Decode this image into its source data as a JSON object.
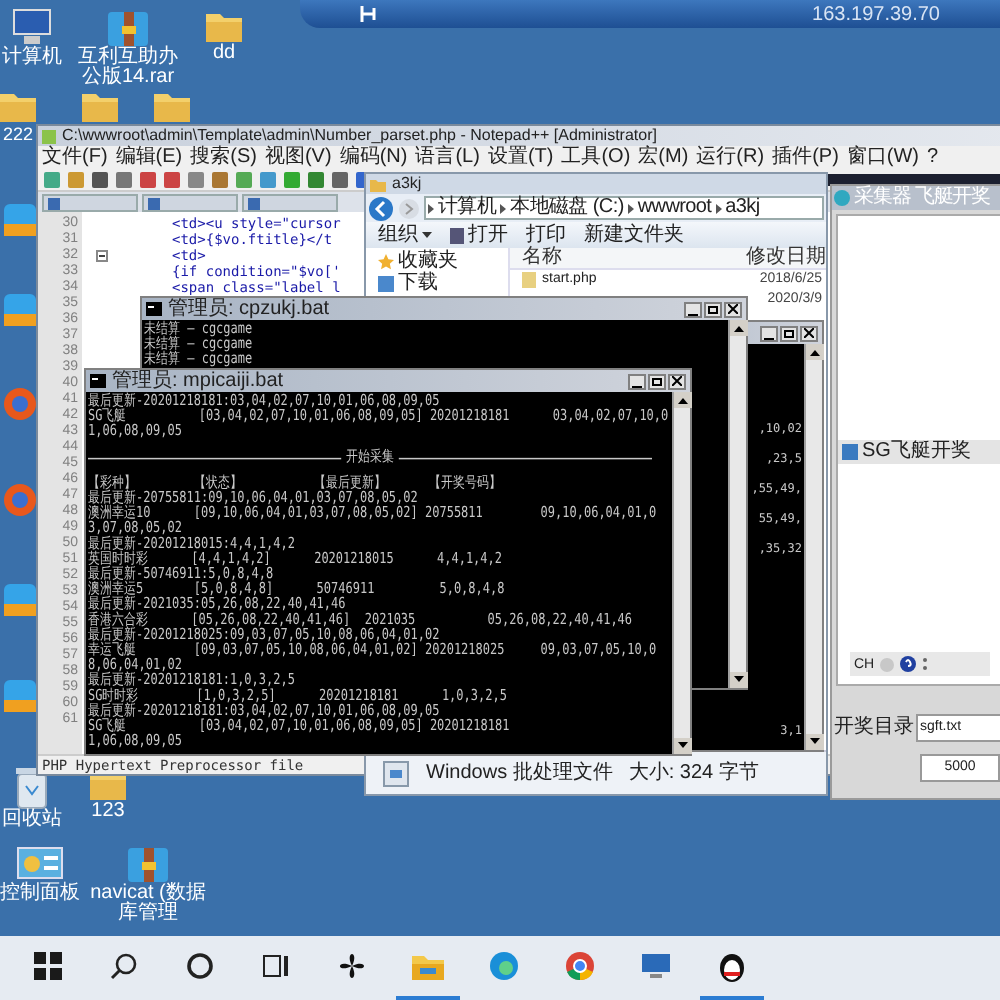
{
  "remote_bar": {
    "address": "163.197.39.70"
  },
  "desktop_icons": [
    {
      "kind": "computer",
      "label": "计算机"
    },
    {
      "kind": "archive",
      "label": "互利互助办公版14.rar"
    },
    {
      "kind": "folder",
      "label": "dd"
    },
    {
      "kind": "folder",
      "label": "222"
    },
    {
      "kind": "folder"
    },
    {
      "kind": "folder"
    },
    {
      "kind": "app"
    },
    {
      "kind": "app"
    },
    {
      "kind": "browser"
    },
    {
      "kind": "browser"
    },
    {
      "kind": "app"
    },
    {
      "kind": "app"
    },
    {
      "kind": "recycle",
      "label": "回收站"
    },
    {
      "kind": "folder",
      "label": "123"
    },
    {
      "kind": "control",
      "label": "控制面板"
    },
    {
      "kind": "archive",
      "label": "navicat (数据库管理"
    }
  ],
  "notepad": {
    "title": "C:\\wwwroot\\admin\\Template\\admin\\Number_parset.php - Notepad++ [Administrator]",
    "menu": [
      "文件(F)",
      "编辑(E)",
      "搜索(S)",
      "视图(V)",
      "编码(N)",
      "语言(L)",
      "设置(T)",
      "工具(O)",
      "宏(M)",
      "运行(R)",
      "插件(P)",
      "窗口(W)",
      "?"
    ],
    "line_numbers": [
      "30",
      "31",
      "32",
      "33",
      "34",
      "35",
      "36",
      "37",
      "38",
      "39",
      "40",
      "41",
      "42",
      "43",
      "44",
      "45",
      "46",
      "47",
      "48",
      "49",
      "50",
      "51",
      "52",
      "53",
      "54",
      "55",
      "56",
      "57",
      "58",
      "59",
      "60",
      "61"
    ],
    "code_lines": [
      {
        "text": "<td><u style=\"cursor",
        "fold": false
      },
      {
        "text": "<td>{$vo.ftitle}</t",
        "fold": false
      },
      {
        "text": "<td>",
        "fold": true
      },
      {
        "text": "{if condition=\"$vo['",
        "fold": false
      },
      {
        "text": "<span class=\"label l",
        "fold": false
      }
    ],
    "status": "PHP Hypertext Preprocessor file"
  },
  "explorer": {
    "title": "a3kj",
    "path": [
      "计算机",
      "本地磁盘 (C:)",
      "wwwroot",
      "a3kj"
    ],
    "toolbar": [
      "组织",
      "打开",
      "打印",
      "新建文件夹"
    ],
    "nav": [
      "收藏夹",
      "下载"
    ],
    "columns": [
      "名称",
      "修改日期"
    ],
    "files": [
      {
        "name": "start.php",
        "date": "2018/6/25"
      },
      {
        "date": "2020/3/9"
      }
    ],
    "status_type": "Windows 批处理文件",
    "status_size": "大小: 324 字节"
  },
  "consoles": [
    {
      "lines": [
        {
          "kind": "text",
          "text": ",10,02"
        },
        {
          "kind": "text",
          "text": ",23,5"
        },
        {
          "kind": "text",
          "text": ",55,49,"
        },
        {
          "kind": "text",
          "text": "55,49,"
        },
        {
          "kind": "text",
          "text": ",35,32"
        },
        {
          "kind": "text",
          "text": "3,1"
        }
      ]
    },
    {
      "title": "管理员: cpzukj.bat",
      "lines": [
        {
          "kind": "text",
          "text": "未结算 — cgcgame"
        },
        {
          "kind": "text",
          "text": "未结算 — cgcgame"
        },
        {
          "kind": "text",
          "text": "未结算 — cgcgame"
        }
      ]
    },
    {
      "title": "管理员: mpicaiji.bat",
      "lines": [
        {
          "kind": "text",
          "text": "最后更新-20201218181:03,04,02,07,10,01,06,08,09,05"
        },
        {
          "kind": "text",
          "text": "SG飞艇          [03,04,02,07,10,01,06,08,09,05] 20201218181      03,04,02,07,10,0"
        },
        {
          "kind": "text",
          "text": "1,06,08,09,05"
        },
        {
          "kind": "rule",
          "text": "开始采集"
        },
        {
          "kind": "text",
          "text": "【彩种】        【状态】          【最后更新】      【开奖号码】"
        },
        {
          "kind": "text",
          "text": "最后更新-20755811:09,10,06,04,01,03,07,08,05,02"
        },
        {
          "kind": "text",
          "text": "澳洲幸运10      [09,10,06,04,01,03,07,08,05,02] 20755811        09,10,06,04,01,0"
        },
        {
          "kind": "text",
          "text": "3,07,08,05,02"
        },
        {
          "kind": "text",
          "text": "最后更新-20201218015:4,4,1,4,2"
        },
        {
          "kind": "text",
          "text": "英国时时彩      [4,4,1,4,2]      20201218015      4,4,1,4,2"
        },
        {
          "kind": "text",
          "text": "最后更新-50746911:5,0,8,4,8"
        },
        {
          "kind": "text",
          "text": "澳洲幸运5       [5,0,8,4,8]      50746911         5,0,8,4,8"
        },
        {
          "kind": "text",
          "text": "最后更新-2021035:05,26,08,22,40,41,46"
        },
        {
          "kind": "text",
          "text": "香港六合彩      [05,26,08,22,40,41,46]  2021035          05,26,08,22,40,41,46"
        },
        {
          "kind": "text",
          "text": "最后更新-20201218025:09,03,07,05,10,08,06,04,01,02"
        },
        {
          "kind": "text",
          "text": "幸运飞艇        [09,03,07,05,10,08,06,04,01,02] 20201218025     09,03,07,05,10,0"
        },
        {
          "kind": "text",
          "text": "8,06,04,01,02"
        },
        {
          "kind": "text",
          "text": "最后更新-20201218181:1,0,3,2,5"
        },
        {
          "kind": "text",
          "text": "SG时时彩        [1,0,3,2,5]      20201218181      1,0,3,2,5"
        },
        {
          "kind": "text",
          "text": "最后更新-20201218181:03,04,02,07,10,01,06,08,09,05"
        },
        {
          "kind": "text",
          "text": "SG飞艇          [03,04,02,07,10,01,06,08,09,05] 20201218181"
        },
        {
          "kind": "text",
          "text": "1,06,08,09,05"
        }
      ]
    }
  ],
  "collector": {
    "title": "采集器 飞艇开奖",
    "panel_title": "SG飞艇开奖",
    "lang": "CH",
    "dir_label": "开奖目录",
    "dir_value": "sgft.txt",
    "interval": "5000"
  },
  "taskbar": {
    "apps": [
      {
        "kind": "start",
        "active": false
      },
      {
        "kind": "search",
        "active": false
      },
      {
        "kind": "cortana",
        "active": false
      },
      {
        "kind": "taskview",
        "active": false
      },
      {
        "kind": "fan",
        "active": false
      },
      {
        "kind": "explorer",
        "active": true
      },
      {
        "kind": "edge",
        "active": false
      },
      {
        "kind": "chrome",
        "active": false
      },
      {
        "kind": "remote",
        "active": false
      },
      {
        "kind": "qq",
        "active": true
      }
    ]
  }
}
